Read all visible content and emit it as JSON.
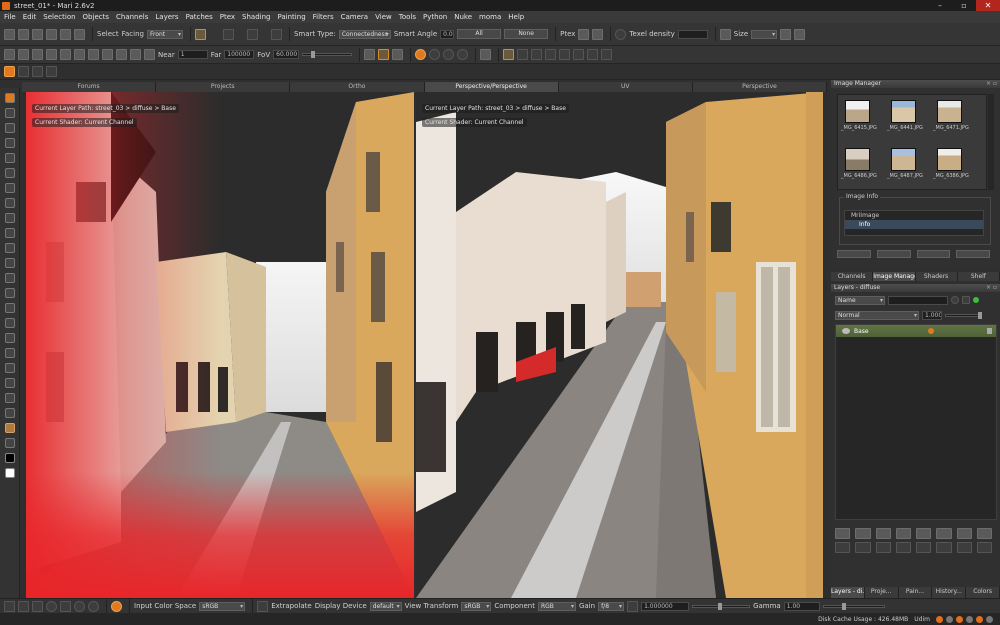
{
  "window": {
    "title": "street_01* - Mari 2.6v2",
    "minimize": "–",
    "maximize": "▫",
    "close": "✕"
  },
  "menu": [
    "File",
    "Edit",
    "Selection",
    "Objects",
    "Channels",
    "Layers",
    "Patches",
    "Ptex",
    "Shading",
    "Painting",
    "Filters",
    "Camera",
    "View",
    "Tools",
    "Python",
    "Nuke",
    "moma",
    "Help"
  ],
  "toolbar1": {
    "select_label": "Select",
    "facing_label": "Facing",
    "facing_value": "Front",
    "smart_type_label": "Smart Type:",
    "smart_type_value": "Connectedness",
    "smart_angle_label": "Smart Angle",
    "smart_angle_value": "0.00",
    "all_label": "All",
    "none_label": "None",
    "ptex_label": "Ptex",
    "texel_label": "Texel density",
    "size_label": "Size"
  },
  "toolbar2": {
    "near_label": "Near",
    "near_value": "1",
    "far_label": "Far",
    "far_value": "100000",
    "fov_label": "FoV",
    "fov_value": "60.000"
  },
  "viewport_tabs": [
    "Forums",
    "Projects",
    "Ortho",
    "Perspective/Perspective",
    "UV",
    "Perspective"
  ],
  "viewport_active_tab": 3,
  "left_view": {
    "layer_path": "Current Layer Path: street_03 > diffuse > Base",
    "shader": "Current Shader: Current Channel"
  },
  "right_view": {
    "layer_path": "Current Layer Path: street_03 > diffuse > Base",
    "shader": "Current Shader: Current Channel"
  },
  "image_manager": {
    "title": "Image Manager",
    "images": [
      "_MG_6415.JPG",
      "_MG_6441.JPG",
      "_MG_6471.JPG",
      "_MG_6486.JPG",
      "_MG_6487.JPG",
      "_MG_6386.JPG"
    ],
    "info_title": "Image Info",
    "info_rows": [
      "MriImage",
      "Info"
    ]
  },
  "mid_tabs": [
    "Channels",
    "Image Manager",
    "Shaders",
    "Shelf"
  ],
  "mid_active_tab": 1,
  "layers": {
    "title": "Layers - diffuse",
    "filter_value": "Name",
    "blend_mode": "Normal",
    "opacity": "1.000",
    "rows": [
      {
        "name": "Base"
      }
    ]
  },
  "bottom_tabs": [
    "Layers - di...",
    "Proje...",
    "Pain...",
    "History...",
    "Colors"
  ],
  "bottom_toolbar": {
    "input_cs_label": "Input Color Space",
    "input_cs_value": "sRGB",
    "extrapolate_label": "Extrapolate",
    "display_device_label": "Display Device",
    "display_device_value": "default",
    "view_transform_label": "View Transform",
    "view_transform_value": "sRGB",
    "component_label": "Component",
    "component_value": "RGB",
    "gain_label": "Gain",
    "gain_value": "f/8",
    "gain_num": "1.000000",
    "gamma_label": "Gamma",
    "gamma_value": "1.00"
  },
  "status": {
    "disk_cache": "Disk Cache Usage : 426.48MB",
    "udim": "Udim"
  },
  "colors": {
    "accent": "#e07a1f",
    "background": "#2f2f2f",
    "paint_red": "#e8262a",
    "facade_yellow": "#d9a85c"
  }
}
